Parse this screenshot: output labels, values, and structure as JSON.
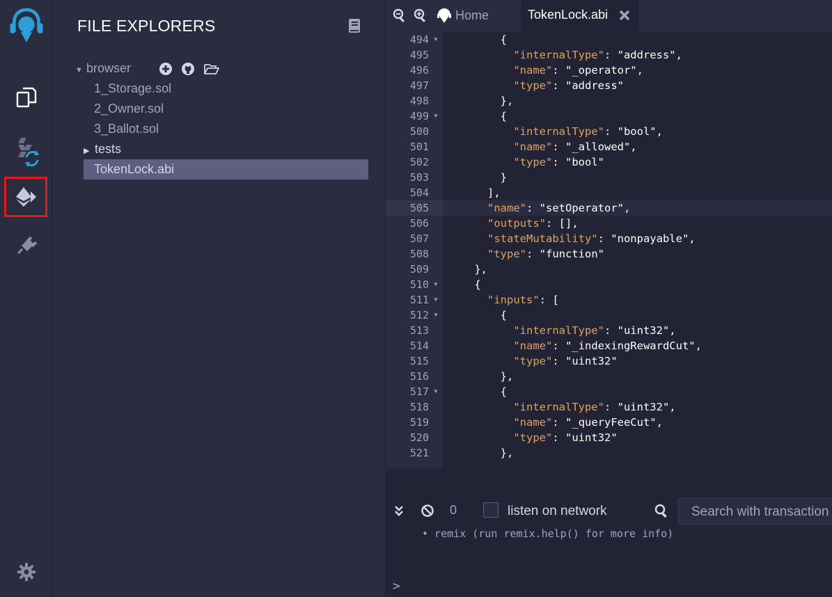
{
  "sidebar_panel": {
    "title": "FILE EXPLORERS",
    "root_label": "browser",
    "files": [
      "1_Storage.sol",
      "2_Owner.sol",
      "3_Ballot.sol"
    ],
    "folder": "tests",
    "selected_file": "TokenLock.abi"
  },
  "tabs": {
    "home_label": "Home",
    "active_tab_label": "TokenLock.abi"
  },
  "editor": {
    "current_line": 505,
    "lines": [
      {
        "n": "494",
        "fold": true,
        "html": "        {"
      },
      {
        "n": "495",
        "fold": false,
        "html": "          <k>\"internalType\"</k>: \"address\","
      },
      {
        "n": "496",
        "fold": false,
        "html": "          <k>\"name\"</k>: \"_operator\","
      },
      {
        "n": "497",
        "fold": false,
        "html": "          <k>\"type\"</k>: \"address\""
      },
      {
        "n": "498",
        "fold": false,
        "html": "        },"
      },
      {
        "n": "499",
        "fold": true,
        "html": "        {"
      },
      {
        "n": "500",
        "fold": false,
        "html": "          <k>\"internalType\"</k>: \"bool\","
      },
      {
        "n": "501",
        "fold": false,
        "html": "          <k>\"name\"</k>: \"_allowed\","
      },
      {
        "n": "502",
        "fold": false,
        "html": "          <k>\"type\"</k>: \"bool\""
      },
      {
        "n": "503",
        "fold": false,
        "html": "        }"
      },
      {
        "n": "504",
        "fold": false,
        "html": "      ],"
      },
      {
        "n": "505",
        "fold": false,
        "html": "      <k>\"name\"</k>: \"setOperator\","
      },
      {
        "n": "506",
        "fold": false,
        "html": "      <k>\"outputs\"</k>: [],"
      },
      {
        "n": "507",
        "fold": false,
        "html": "      <k>\"stateMutability\"</k>: \"nonpayable\","
      },
      {
        "n": "508",
        "fold": false,
        "html": "      <k>\"type\"</k>: \"function\""
      },
      {
        "n": "509",
        "fold": false,
        "html": "    },"
      },
      {
        "n": "510",
        "fold": true,
        "html": "    {"
      },
      {
        "n": "511",
        "fold": true,
        "html": "      <k>\"inputs\"</k>: ["
      },
      {
        "n": "512",
        "fold": true,
        "html": "        {"
      },
      {
        "n": "513",
        "fold": false,
        "html": "          <k>\"internalType\"</k>: \"uint32\","
      },
      {
        "n": "514",
        "fold": false,
        "html": "          <k>\"name\"</k>: \"_indexingRewardCut\","
      },
      {
        "n": "515",
        "fold": false,
        "html": "          <k>\"type\"</k>: \"uint32\""
      },
      {
        "n": "516",
        "fold": false,
        "html": "        },"
      },
      {
        "n": "517",
        "fold": true,
        "html": "        {"
      },
      {
        "n": "518",
        "fold": false,
        "html": "          <k>\"internalType\"</k>: \"uint32\","
      },
      {
        "n": "519",
        "fold": false,
        "html": "          <k>\"name\"</k>: \"_queryFeeCut\","
      },
      {
        "n": "520",
        "fold": false,
        "html": "          <k>\"type\"</k>: \"uint32\""
      },
      {
        "n": "521",
        "fold": false,
        "html": "        },"
      }
    ]
  },
  "terminal": {
    "tx_count": "0",
    "listen_label": "listen on network",
    "search_placeholder": "Search with transaction hash or address",
    "log_line": "• remix (run remix.help() for more info)",
    "prompt": ">"
  },
  "colors": {
    "accent_red": "#e0191b",
    "key_orange": "#e2a25a",
    "logo_blue": "#2b9fd8"
  }
}
